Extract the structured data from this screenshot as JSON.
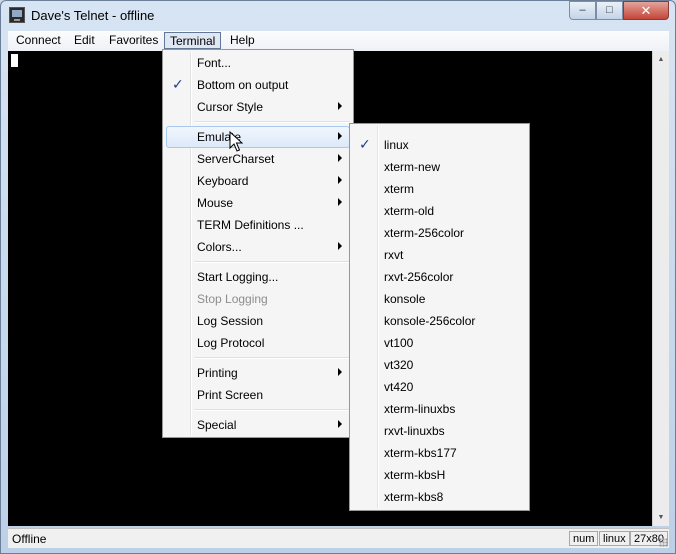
{
  "window": {
    "title": "Dave's Telnet - offline"
  },
  "caption": {
    "minimize": "–",
    "maximize": "□",
    "close": "✕"
  },
  "menubar": {
    "items": [
      "Connect",
      "Edit",
      "Favorites",
      "Terminal",
      "Help"
    ],
    "active": "Terminal"
  },
  "terminal_menu": {
    "items": [
      {
        "label": "Font...",
        "checked": false,
        "submenu": false,
        "disabled": false
      },
      {
        "label": "Bottom on output",
        "checked": true,
        "submenu": false,
        "disabled": false
      },
      {
        "label": "Cursor Style",
        "checked": false,
        "submenu": true,
        "disabled": false
      },
      {
        "label": "Emulate",
        "checked": false,
        "submenu": true,
        "disabled": false,
        "highlighted": true
      },
      {
        "label": "ServerCharset",
        "checked": false,
        "submenu": true,
        "disabled": false
      },
      {
        "label": "Keyboard",
        "checked": false,
        "submenu": true,
        "disabled": false
      },
      {
        "label": "Mouse",
        "checked": false,
        "submenu": true,
        "disabled": false
      },
      {
        "label": "TERM Definitions ...",
        "checked": false,
        "submenu": false,
        "disabled": false
      },
      {
        "label": "Colors...",
        "checked": false,
        "submenu": true,
        "disabled": false
      },
      {
        "label": "Start Logging...",
        "checked": false,
        "submenu": false,
        "disabled": false
      },
      {
        "label": "Stop Logging",
        "checked": false,
        "submenu": false,
        "disabled": true
      },
      {
        "label": "Log Session",
        "checked": false,
        "submenu": false,
        "disabled": false
      },
      {
        "label": "Log Protocol",
        "checked": false,
        "submenu": false,
        "disabled": false
      },
      {
        "label": "Printing",
        "checked": false,
        "submenu": true,
        "disabled": false
      },
      {
        "label": "Print Screen",
        "checked": false,
        "submenu": false,
        "disabled": false
      },
      {
        "label": "Special",
        "checked": false,
        "submenu": true,
        "disabled": false
      }
    ]
  },
  "emulate_menu": {
    "items": [
      {
        "label": "linux",
        "checked": true
      },
      {
        "label": "xterm-new",
        "checked": false
      },
      {
        "label": "xterm",
        "checked": false
      },
      {
        "label": "xterm-old",
        "checked": false
      },
      {
        "label": "xterm-256color",
        "checked": false
      },
      {
        "label": "rxvt",
        "checked": false
      },
      {
        "label": "rxvt-256color",
        "checked": false
      },
      {
        "label": "konsole",
        "checked": false
      },
      {
        "label": "konsole-256color",
        "checked": false
      },
      {
        "label": "vt100",
        "checked": false
      },
      {
        "label": "vt320",
        "checked": false
      },
      {
        "label": "vt420",
        "checked": false
      },
      {
        "label": "xterm-linuxbs",
        "checked": false
      },
      {
        "label": "rxvt-linuxbs",
        "checked": false
      },
      {
        "label": "xterm-kbs177",
        "checked": false
      },
      {
        "label": "xterm-kbsH",
        "checked": false
      },
      {
        "label": "xterm-kbs8",
        "checked": false
      }
    ]
  },
  "statusbar": {
    "status": "Offline",
    "panels": [
      "num",
      "linux",
      "27x80"
    ]
  },
  "colors": {
    "terminal_bg": "#000000",
    "check": "#1f3d8a",
    "highlight_border": "#a8c8f0"
  }
}
